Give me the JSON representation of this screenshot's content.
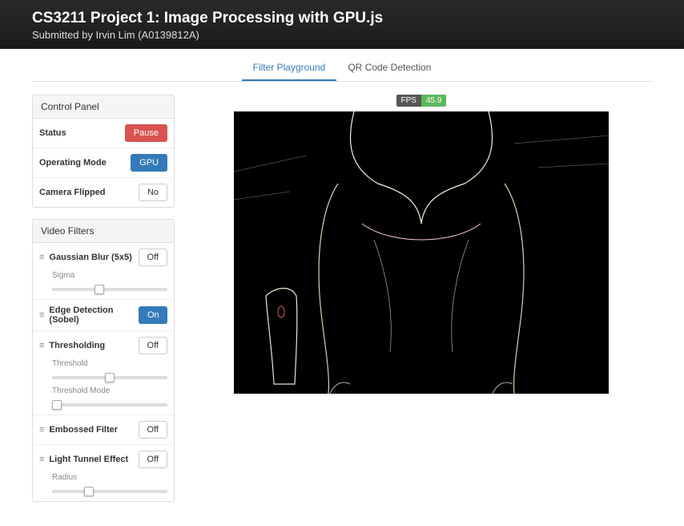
{
  "header": {
    "title": "CS3211 Project 1: Image Processing with GPU.js",
    "subtitle": "Submitted by Irvin Lim (A0139812A)"
  },
  "tabs": {
    "playground": "Filter Playground",
    "qr": "QR Code Detection"
  },
  "control": {
    "title": "Control Panel",
    "status_label": "Status",
    "status_btn": "Pause",
    "mode_label": "Operating Mode",
    "mode_btn": "GPU",
    "flip_label": "Camera Flipped",
    "flip_btn": "No"
  },
  "filters": {
    "title": "Video Filters",
    "items": [
      {
        "name": "Gaussian Blur (5x5)",
        "state": "Off",
        "params": [
          {
            "label": "Sigma",
            "value": 40
          }
        ]
      },
      {
        "name": "Edge Detection (Sobel)",
        "state": "On",
        "params": []
      },
      {
        "name": "Thresholding",
        "state": "Off",
        "params": [
          {
            "label": "Threshold",
            "value": 50
          },
          {
            "label": "Threshold Mode",
            "value": 0
          }
        ]
      },
      {
        "name": "Embossed Filter",
        "state": "Off",
        "params": []
      },
      {
        "name": "Light Tunnel Effect",
        "state": "Off",
        "params": [
          {
            "label": "Radius",
            "value": 30
          }
        ]
      }
    ]
  },
  "fps": {
    "label": "FPS",
    "value": "45.9"
  }
}
